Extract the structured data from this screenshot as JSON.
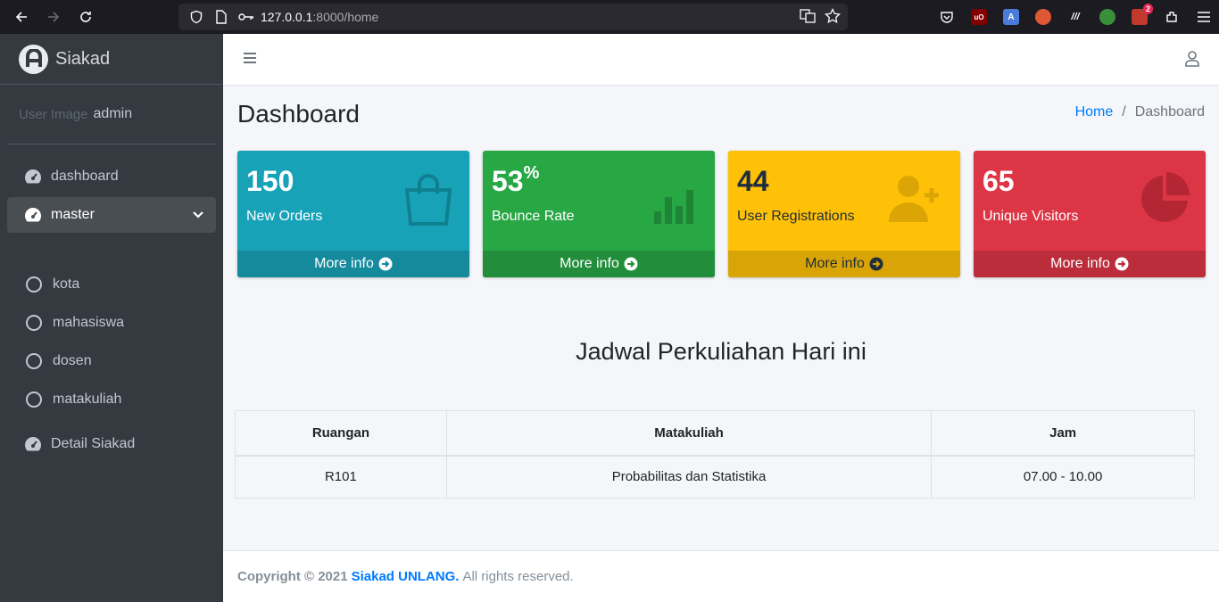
{
  "browser": {
    "url_host": "127.0.0.1",
    "url_path": ":8000/home",
    "ext_badge": "2"
  },
  "sidebar": {
    "brand": "Siakad",
    "user_image_alt": "User Image",
    "user_name": "admin",
    "items": [
      {
        "label": "dashboard",
        "icon": "tachometer-icon"
      },
      {
        "label": "master",
        "icon": "tachometer-icon"
      }
    ],
    "sub_items": [
      {
        "label": "kota"
      },
      {
        "label": "mahasiswa"
      },
      {
        "label": "dosen"
      },
      {
        "label": "matakuliah"
      }
    ],
    "detail": {
      "label": "Detail Siakad",
      "icon": "tachometer-icon"
    }
  },
  "header": {
    "title": "Dashboard",
    "breadcrumb": {
      "home": "Home",
      "current": "Dashboard"
    }
  },
  "boxes": [
    {
      "value": "150",
      "suffix": "",
      "label": "New Orders",
      "more": "More info",
      "icon": "shopping-bag-icon",
      "color": "#17a2b8"
    },
    {
      "value": "53",
      "suffix": "%",
      "label": "Bounce Rate",
      "more": "More info",
      "icon": "bar-chart-icon",
      "color": "#28a745"
    },
    {
      "value": "44",
      "suffix": "",
      "label": "User Registrations",
      "more": "More info",
      "icon": "user-plus-icon",
      "color": "#ffc107"
    },
    {
      "value": "65",
      "suffix": "",
      "label": "Unique Visitors",
      "more": "More info",
      "icon": "pie-chart-icon",
      "color": "#dc3545"
    }
  ],
  "schedule": {
    "title": "Jadwal Perkuliahan Hari ini",
    "columns": [
      "Ruangan",
      "Matakuliah",
      "Jam"
    ],
    "rows": [
      [
        "R101",
        "Probabilitas dan Statistika",
        "07.00 - 10.00"
      ]
    ]
  },
  "footer": {
    "prefix": "Copyright © 2021",
    "brand": "Siakad UNLANG.",
    "suffix": "All rights reserved."
  }
}
